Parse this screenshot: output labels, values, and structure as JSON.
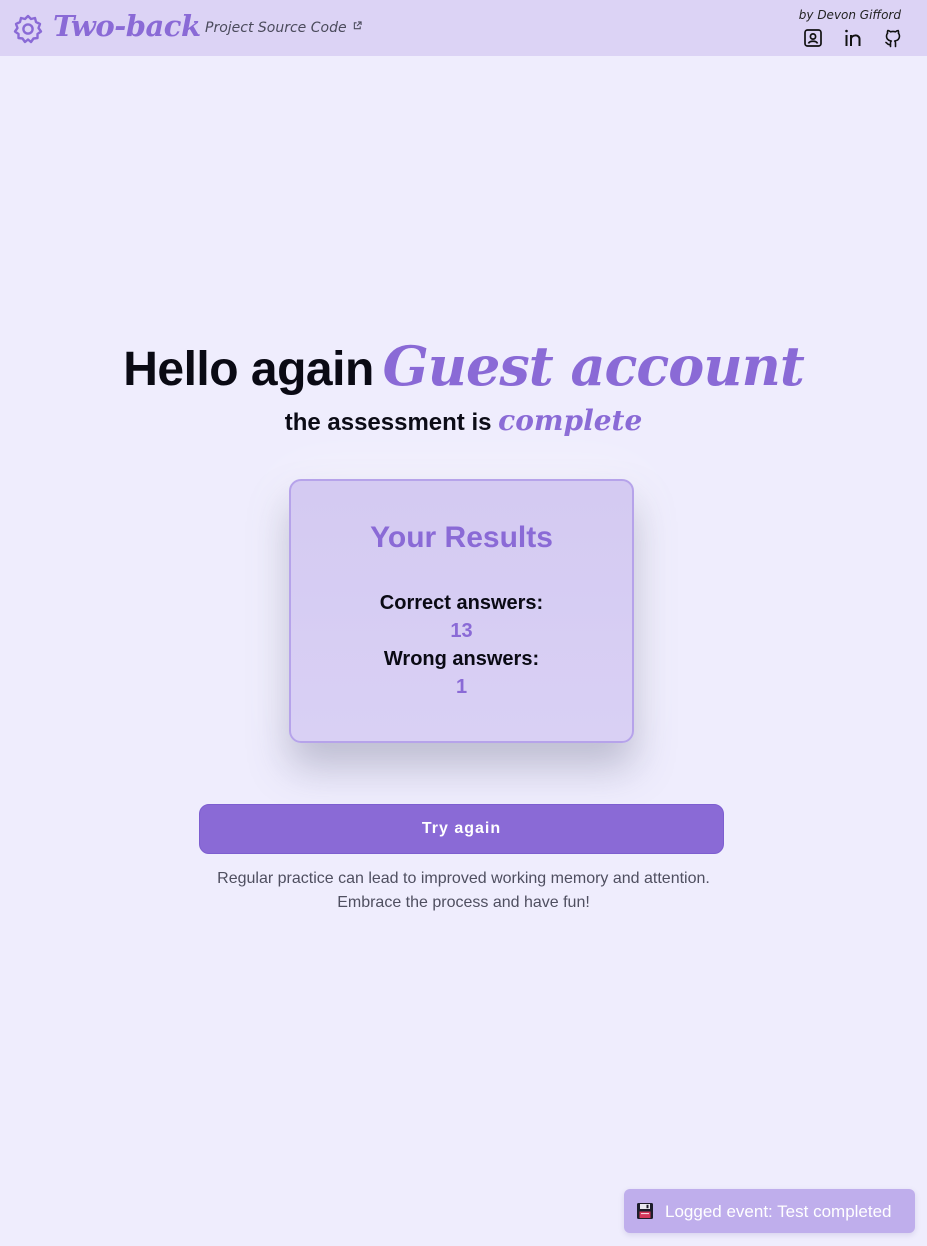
{
  "header": {
    "brand": "Two-back",
    "source_link": "Project Source Code",
    "byline": "by Devon Gifford",
    "icons": {
      "logo": "gear-flower-icon",
      "external": "external-link-icon",
      "contact": "contact-card-icon",
      "linkedin": "linkedin-icon",
      "github": "github-icon"
    }
  },
  "main": {
    "greeting": "Hello again",
    "username": "Guest account",
    "status_prefix": "the assessment is",
    "status_word": "complete"
  },
  "results": {
    "title": "Your Results",
    "correct_label": "Correct answers:",
    "correct_value": "13",
    "wrong_label": "Wrong answers:",
    "wrong_value": "1"
  },
  "actions": {
    "try_again_label": "Try again"
  },
  "tips": {
    "line1": "Regular practice can lead to improved working memory and attention.",
    "line2": "Embrace the process and have fun!"
  },
  "toast": {
    "icon": "floppy-disk-icon",
    "message": "Logged event: Test completed"
  },
  "colors": {
    "accent": "#8a6ad6",
    "background": "#efedfd",
    "header_bg": "#dcd3f5",
    "toast_bg": "#bfaeec"
  }
}
